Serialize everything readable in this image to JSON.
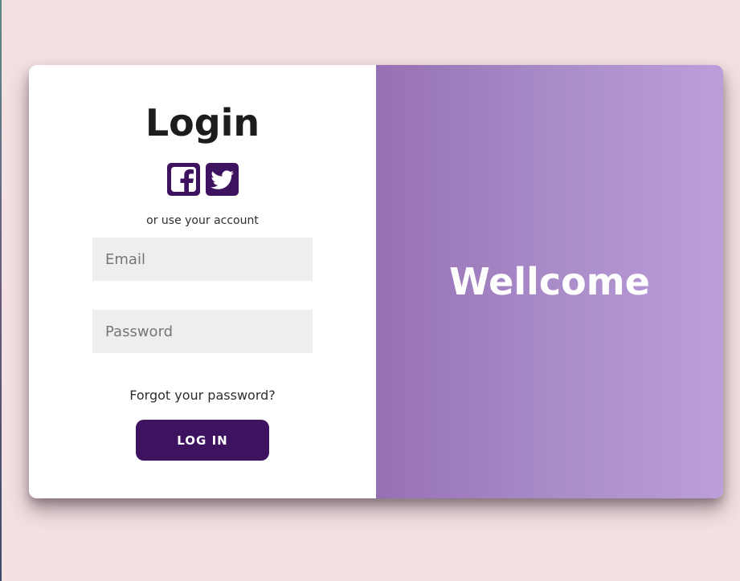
{
  "login_form": {
    "title": "Login",
    "social": [
      {
        "name": "facebook",
        "icon": "facebook-icon"
      },
      {
        "name": "twitter",
        "icon": "twitter-icon"
      }
    ],
    "hint": "or use your account",
    "email": {
      "value": "",
      "placeholder": "Email"
    },
    "password": {
      "value": "",
      "placeholder": "Password"
    },
    "forgot_label": "Forgot your password?",
    "submit_label": "LOG IN"
  },
  "welcome": {
    "heading": "Wellcome"
  },
  "colors": {
    "background": "#f2e0e2",
    "accent": "#3d1360",
    "gradient_start": "#9670b4",
    "gradient_end": "#bd9edb",
    "input_bg": "#eeeeee"
  }
}
